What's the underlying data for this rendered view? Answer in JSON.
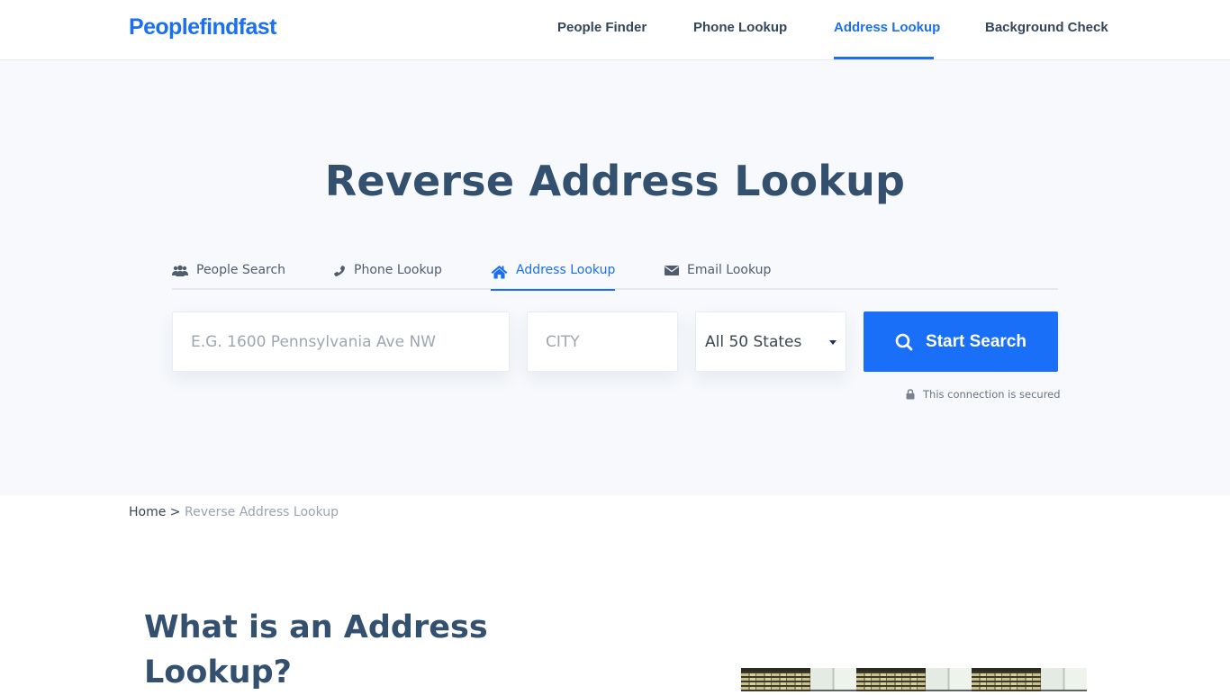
{
  "header": {
    "logo": "Peoplefindfast",
    "nav": [
      {
        "label": "People Finder",
        "active": false
      },
      {
        "label": "Phone Lookup",
        "active": false
      },
      {
        "label": "Address Lookup",
        "active": true
      },
      {
        "label": "Background Check",
        "active": false
      }
    ]
  },
  "hero": {
    "title": "Reverse Address Lookup",
    "tabs": [
      {
        "label": "People Search",
        "icon": "users-icon",
        "active": false
      },
      {
        "label": "Phone Lookup",
        "icon": "phone-icon",
        "active": false
      },
      {
        "label": "Address Lookup",
        "icon": "home-icon",
        "active": true
      },
      {
        "label": "Email Lookup",
        "icon": "envelope-icon",
        "active": false
      }
    ],
    "form": {
      "address_placeholder": "E.G. 1600 Pennsylvania Ave NW",
      "address_value": "",
      "city_placeholder": "CITY",
      "city_value": "",
      "state_selected": "All 50 States",
      "search_label": "Start Search",
      "secure_text": "This connection is secured"
    }
  },
  "breadcrumb": {
    "home": "Home",
    "separator": ">",
    "current": "Reverse Address Lookup"
  },
  "content": {
    "title": "What is an Address Lookup?"
  },
  "colors": {
    "brand": "#1a6ff2",
    "heading": "#34506f",
    "hero_bg": "#f7f9fc"
  }
}
